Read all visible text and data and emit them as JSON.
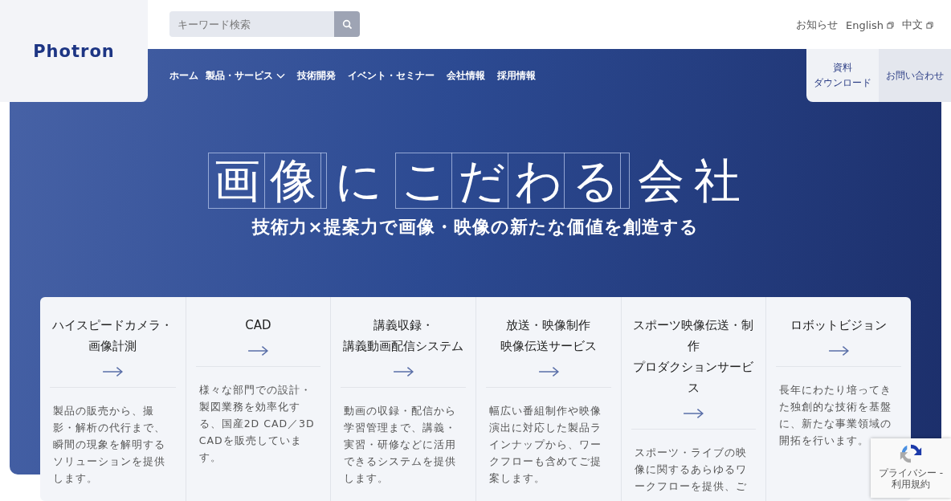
{
  "header": {
    "logo": "Photron",
    "search": {
      "placeholder": "キーワード検索"
    },
    "top_links": [
      {
        "label": "お知らせ",
        "external": false
      },
      {
        "label": "English",
        "external": true
      },
      {
        "label": "中文",
        "external": true
      }
    ]
  },
  "nav": [
    {
      "label": "ホーム",
      "has_dropdown": false
    },
    {
      "label": "製品・サービス",
      "has_dropdown": true
    },
    {
      "label": "技術開発",
      "has_dropdown": false
    },
    {
      "label": "イベント・セミナー",
      "has_dropdown": false
    },
    {
      "label": "会社情報",
      "has_dropdown": false
    },
    {
      "label": "採用情報",
      "has_dropdown": false
    }
  ],
  "action_buttons": [
    [
      "資料",
      "ダウンロード"
    ],
    [
      "お問い合わせ"
    ]
  ],
  "hero": {
    "headline": [
      {
        "text": "画像",
        "boxed": true
      },
      {
        "text": "に",
        "boxed": false
      },
      {
        "text": "こだわる",
        "boxed": true
      },
      {
        "text": "会社",
        "boxed": false
      }
    ],
    "subtitle": "技術力×提案力で画像・映像の新たな価値を創造する"
  },
  "cards": [
    {
      "title": [
        "ハイスピードカメラ・",
        "画像計測"
      ],
      "description": "製品の販売から、撮影・解析の代行まで、瞬間の現象を解明するソリューションを提供します。"
    },
    {
      "title": [
        "CAD"
      ],
      "description": "様々な部門での設計・製図業務を効率化する、国産2D CAD／3D CADを販売しています。"
    },
    {
      "title": [
        "講義収録・",
        "講義動画配信システム"
      ],
      "description": "動画の収録・配信から学習管理まで、講義・実習・研修などに活用できるシステムを提供します。"
    },
    {
      "title": [
        "放送・映像制作",
        "映像伝送サービス"
      ],
      "description": "幅広い番組制作や映像演出に対応した製品ラインナップから、ワークフローも含めてご提案します。"
    },
    {
      "title": [
        "スポーツ映像伝送・制作",
        "プロダクションサービス"
      ],
      "description": "スポーツ・ライブの映像に関するあらゆるワークフローを提供、ご"
    },
    {
      "title": [
        "ロボットビジョン"
      ],
      "description": "長年にわたり培ってきた独創的な技術を基盤に、新たな事業領域の開拓を行います。"
    }
  ],
  "recaptcha": {
    "links": "プライバシー - 利用規約"
  }
}
